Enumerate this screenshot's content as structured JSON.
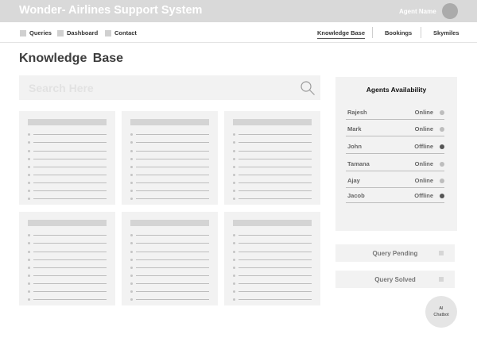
{
  "header": {
    "app_title": "Wonder- Airlines Support System",
    "agent_name": "Agent Name"
  },
  "nav": {
    "left": [
      {
        "label": "Queries",
        "icon": "square-icon"
      },
      {
        "label": "Dashboard",
        "icon": "square-icon"
      },
      {
        "label": "Contact",
        "icon": "square-icon"
      }
    ],
    "right": [
      {
        "label": "Knowledge Base",
        "active": true
      },
      {
        "label": "Bookings",
        "active": false
      },
      {
        "label": "Skymiles",
        "active": false
      }
    ]
  },
  "page": {
    "title": "Knowledge  Base"
  },
  "search": {
    "placeholder": "Search Here",
    "value": ""
  },
  "agents": {
    "title": "Agents Availability",
    "list": [
      {
        "name": "Rajesh",
        "status": "Online"
      },
      {
        "name": "Mark",
        "status": "Online"
      },
      {
        "name": "John",
        "status": "Offline"
      },
      {
        "name": "Tamana",
        "status": "Online"
      },
      {
        "name": "Ajay",
        "status": "Online"
      },
      {
        "name": "Jacob",
        "status": "Offline"
      }
    ]
  },
  "queries": {
    "pending_label": "Query Pending",
    "solved_label": "Query Solved"
  },
  "chatbot": {
    "line1": "AI",
    "line2": "Chatbot"
  },
  "colors": {
    "topbar": "#d9d9d9",
    "panel": "#f2f2f2",
    "offline_dot": "#555555",
    "online_dot": "#bdbdbd"
  }
}
